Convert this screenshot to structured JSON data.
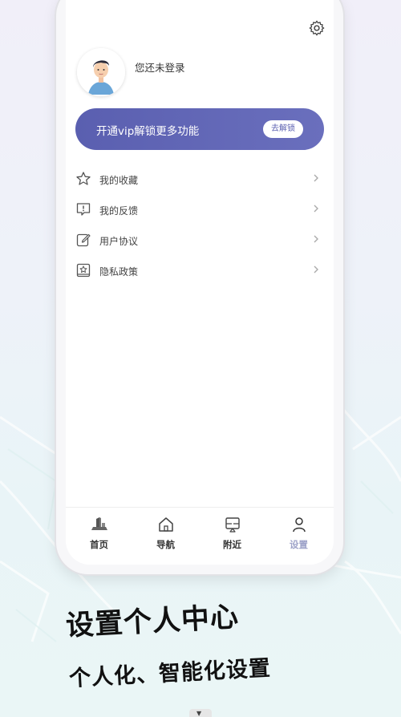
{
  "profile": {
    "login_status": "您还未登录"
  },
  "vip_banner": {
    "text": "开通vip解锁更多功能",
    "button_label": "去解锁"
  },
  "menu": {
    "items": [
      {
        "label": "我的收藏",
        "icon": "star-icon"
      },
      {
        "label": "我的反馈",
        "icon": "feedback-icon"
      },
      {
        "label": "用户协议",
        "icon": "edit-icon"
      },
      {
        "label": "隐私政策",
        "icon": "privacy-icon"
      }
    ]
  },
  "tabbar": {
    "tabs": [
      {
        "label": "首页",
        "icon": "building-icon",
        "active": false
      },
      {
        "label": "导航",
        "icon": "home-icon",
        "active": false
      },
      {
        "label": "附近",
        "icon": "nearby-icon",
        "active": false
      },
      {
        "label": "设置",
        "icon": "person-icon",
        "active": true
      }
    ]
  },
  "promo": {
    "headline": "设置个人中心",
    "subline": "个人化、智能化设置"
  },
  "colors": {
    "accent": "#5a5fb0",
    "active_tab": "#9ea3c9",
    "text": "#333333"
  }
}
